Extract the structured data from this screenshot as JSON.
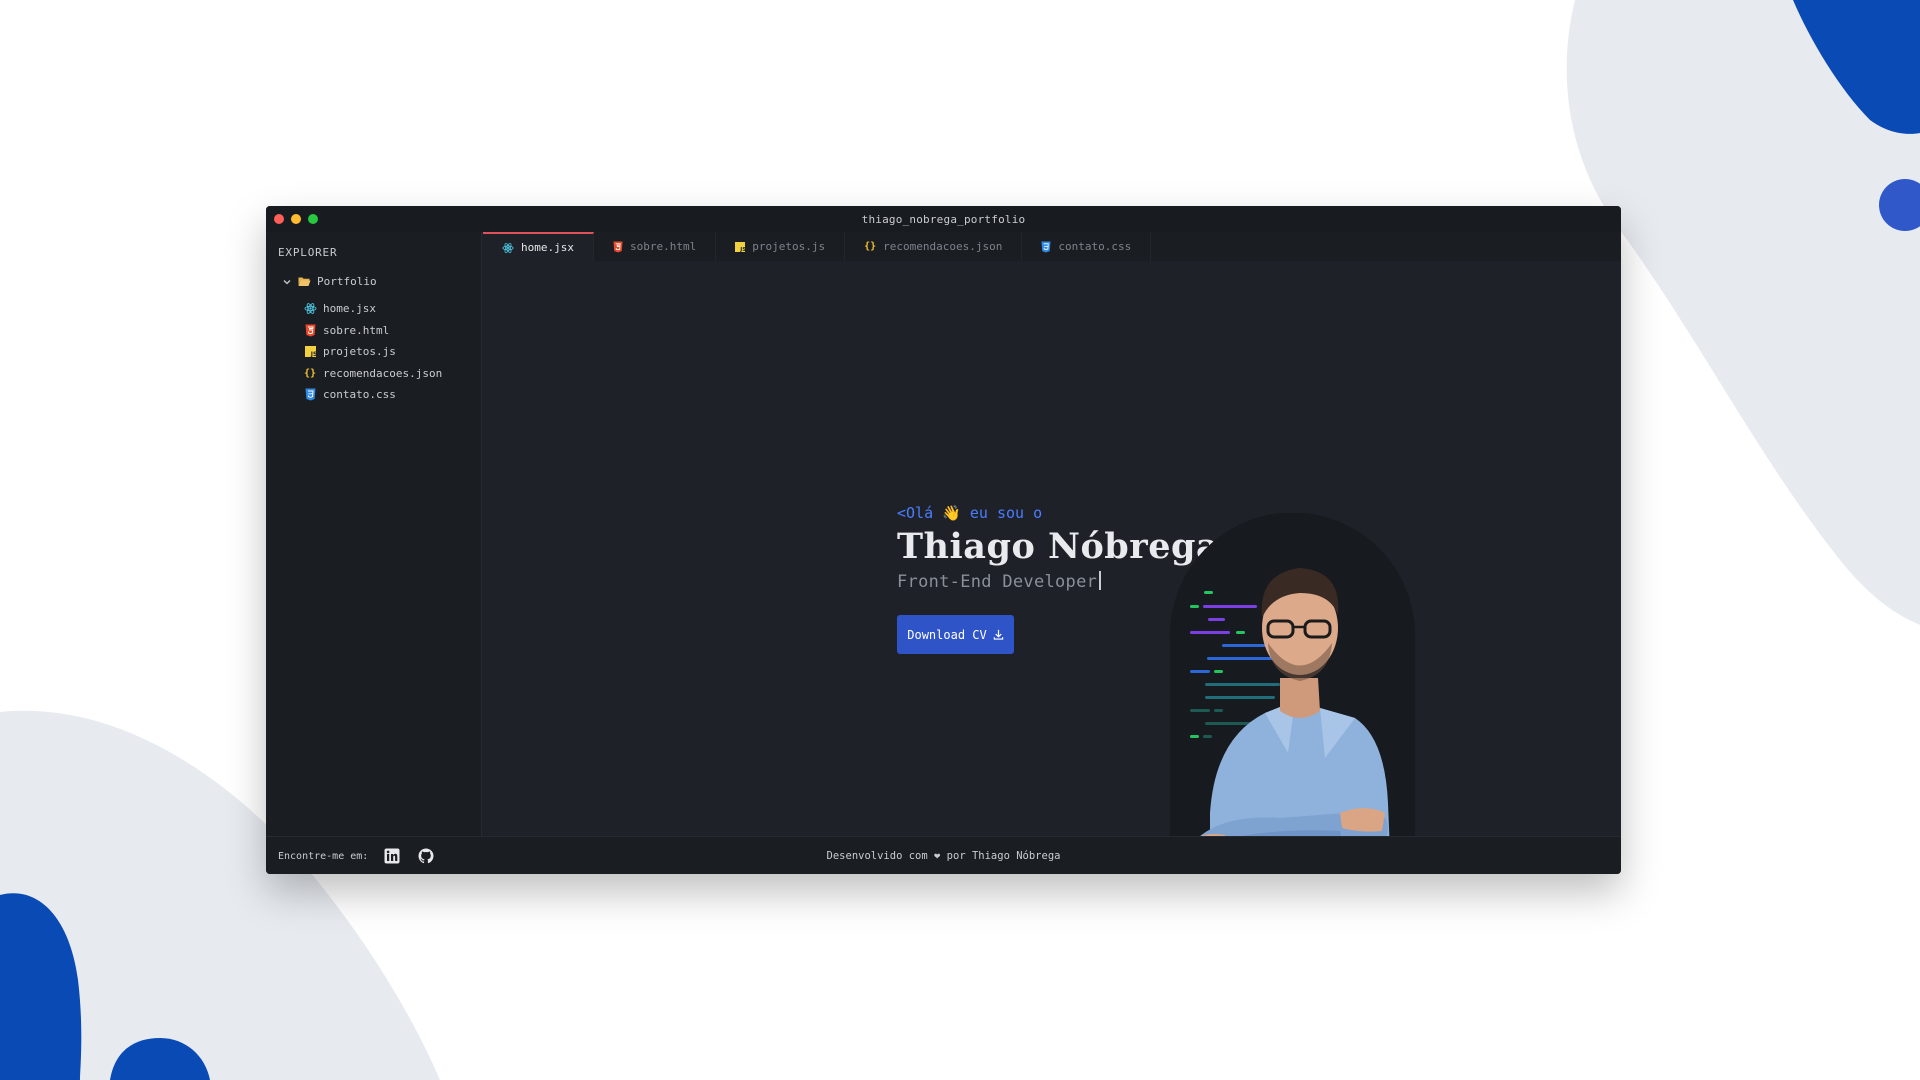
{
  "colors": {
    "accent": "#2e54c8",
    "greeting": "#4a7cff",
    "blob_light": "#e7ebf0",
    "blob_dark": "#0a4ab5",
    "active_tab_border": "#e0525a"
  },
  "window": {
    "title": "thiago_nobrega_portfolio"
  },
  "sidebar": {
    "title": "EXPLORER",
    "folder": {
      "label": "Portfolio",
      "icon": "folder-open-icon",
      "chevron": "chevron-down-icon"
    },
    "files": [
      {
        "label": "home.jsx",
        "icon": "react-icon"
      },
      {
        "label": "sobre.html",
        "icon": "html5-icon"
      },
      {
        "label": "projetos.js",
        "icon": "javascript-icon"
      },
      {
        "label": "recomendacoes.json",
        "icon": "json-icon"
      },
      {
        "label": "contato.css",
        "icon": "css3-icon"
      }
    ]
  },
  "tabs": [
    {
      "label": "home.jsx",
      "icon": "react-icon",
      "active": true
    },
    {
      "label": "sobre.html",
      "icon": "html5-icon",
      "active": false
    },
    {
      "label": "projetos.js",
      "icon": "javascript-icon",
      "active": false
    },
    {
      "label": "recomendacoes.json",
      "icon": "json-icon",
      "active": false
    },
    {
      "label": "contato.css",
      "icon": "css3-icon",
      "active": false
    }
  ],
  "hero": {
    "greeting_prefix": "<Olá",
    "greeting_emoji": "👋",
    "greeting_suffix": "eu sou o",
    "name": "Thiago Nóbrega",
    "logo_icon": "code-slash-logo-icon",
    "role": "Front-End Developer",
    "download_label": "Download CV",
    "download_icon": "download-icon"
  },
  "footer": {
    "find_me": "Encontre-me em:",
    "social_icons": [
      "linkedin-icon",
      "github-icon"
    ],
    "credit_prefix": "Desenvolvido com",
    "credit_heart": "❤",
    "credit_suffix": "por Thiago Nóbrega"
  }
}
